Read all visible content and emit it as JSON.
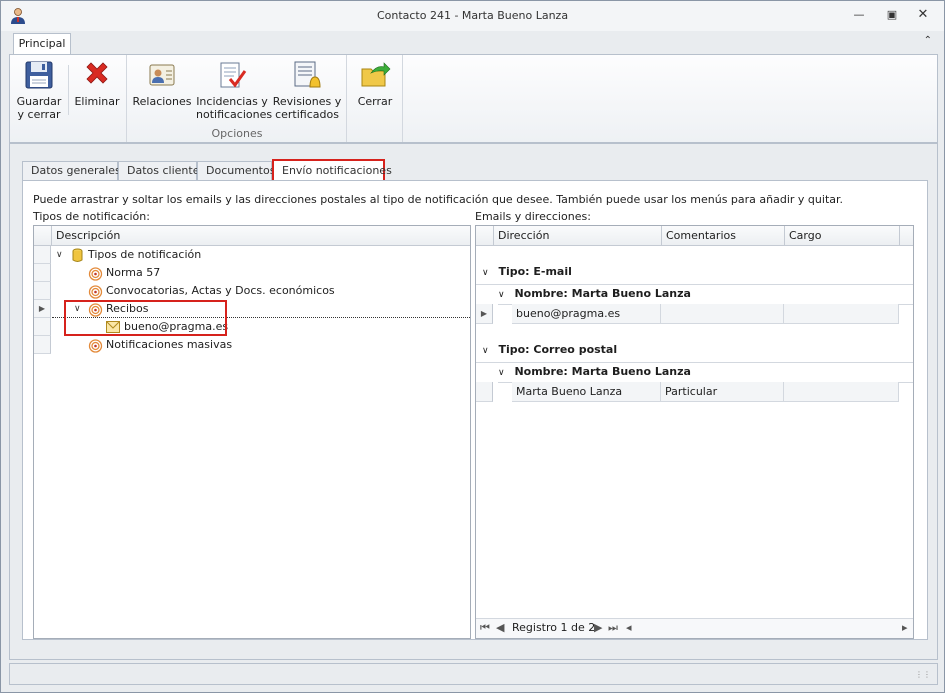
{
  "window": {
    "title": "Contacto 241 - Marta Bueno Lanza",
    "controls": [
      "minimize-icon",
      "restore-icon",
      "close-icon"
    ]
  },
  "ribbon": {
    "tab": "Principal",
    "buttons": {
      "save": "Guardar\ny cerrar",
      "delete": "Eliminar",
      "relations": "Relaciones",
      "incidents": "Incidencias y\nnotificaciones",
      "reviews": "Revisiones y\ncertificados",
      "close": "Cerrar"
    },
    "group_label": "Opciones"
  },
  "tabs": [
    "Datos generales",
    "Datos cliente",
    "Documentos",
    "Envío notificaciones"
  ],
  "active_tab": "Envío notificaciones",
  "hint": "Puede arrastrar y soltar los emails y las direcciones postales al tipo de notificación que desee. También puede usar los menús para añadir y quitar.",
  "left": {
    "label": "Tipos de notificación:",
    "column": "Descripción",
    "tree": [
      {
        "text": "Tipos de notificación",
        "icon": "database-icon",
        "level": 0,
        "expanded": true
      },
      {
        "text": "Norma 57",
        "icon": "broadcast-icon",
        "level": 1
      },
      {
        "text": "Convocatorias, Actas y Docs. económicos",
        "icon": "broadcast-icon",
        "level": 1
      },
      {
        "text": "Recibos",
        "icon": "broadcast-icon",
        "level": 1,
        "expanded": true,
        "selected": true
      },
      {
        "text": "bueno@pragma.es",
        "icon": "envelope-icon",
        "level": 2
      },
      {
        "text": "Notificaciones masivas",
        "icon": "broadcast-icon",
        "level": 1
      }
    ]
  },
  "right": {
    "label": "Emails y direcciones:",
    "columns": [
      "Dirección",
      "Comentarios",
      "Cargo"
    ],
    "groups": [
      {
        "type_label": "Tipo: E-mail",
        "name_label": "Nombre: Marta Bueno Lanza",
        "rows": [
          [
            "bueno@pragma.es",
            "",
            ""
          ]
        ]
      },
      {
        "type_label": "Tipo: Correo postal",
        "name_label": "Nombre: Marta Bueno Lanza",
        "rows": [
          [
            "Marta Bueno Lanza",
            "Particular",
            ""
          ]
        ]
      }
    ],
    "navigator": "Registro 1 de 2"
  },
  "colors": {
    "accent_red": "#d6221c",
    "border": "#a5adb8"
  }
}
